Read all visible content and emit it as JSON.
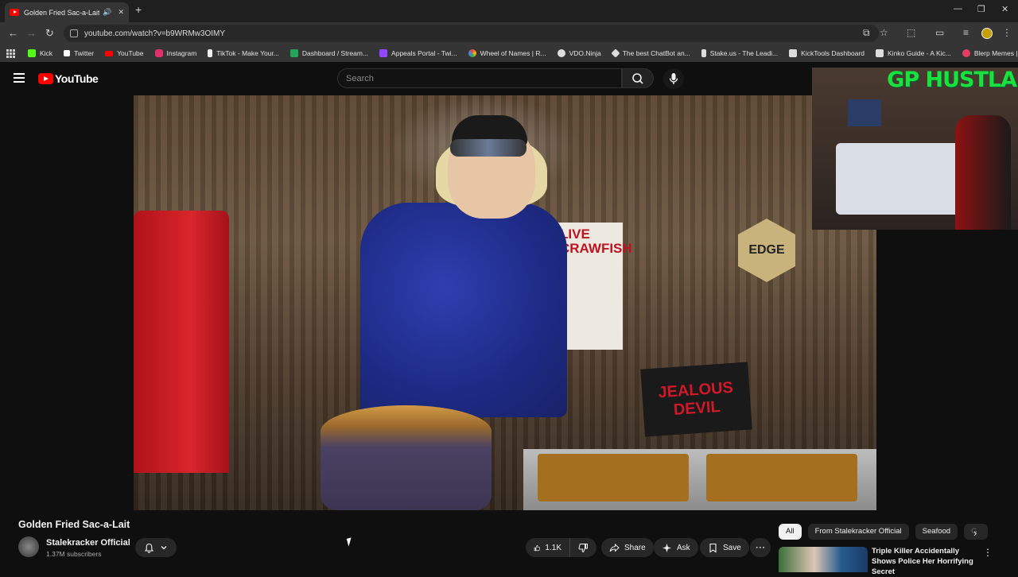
{
  "browser": {
    "tab_title": "Golden Fried Sac-a-Lait - Yo",
    "url": "youtube.com/watch?v=b9WRMw3OIMY",
    "window_controls": [
      "—",
      "❐",
      "✕"
    ]
  },
  "bookmarks": [
    {
      "label": "Kick",
      "color": "#53fc18"
    },
    {
      "label": "Twitter",
      "color": "#ffffff"
    },
    {
      "label": "YouTube",
      "color": "#ff0000"
    },
    {
      "label": "Instagram",
      "color": "#e1306c"
    },
    {
      "label": "TikTok - Make Your...",
      "color": "#ffffff"
    },
    {
      "label": "Dashboard / Stream...",
      "color": "#23a559"
    },
    {
      "label": "Appeals Portal - Twi...",
      "color": "#9146ff"
    },
    {
      "label": "Wheel of Names | R...",
      "color": "#4285f4"
    },
    {
      "label": "VDO.Ninja",
      "color": "#dddddd"
    },
    {
      "label": "The best ChatBot an...",
      "color": "#dddddd"
    },
    {
      "label": "Stake.us - The Leadi...",
      "color": "#1a2c38"
    },
    {
      "label": "KickTools Dashboard",
      "color": "#dddddd"
    },
    {
      "label": "Kinko Guide - A Kic...",
      "color": "#dddddd"
    },
    {
      "label": "Blerp Memes | Best...",
      "color": "#e63e62"
    }
  ],
  "youtube": {
    "logo_text": "YouTube",
    "search_placeholder": "Search"
  },
  "video_scene": {
    "signs": {
      "edge_text": "EDGE",
      "jealous_line1": "JEALOUS",
      "jealous_line2": "DEVIL",
      "crawfish_line1": "LIVE",
      "crawfish_line2": "CRAWFISH"
    }
  },
  "webcam": {
    "overlay_text": "GP HUSTLA"
  },
  "video_info": {
    "title": "Golden Fried Sac-a-Lait",
    "channel_name": "Stalekracker Official",
    "subscribers": "1.37M subscribers",
    "likes": "1.1K",
    "share_label": "Share",
    "ask_label": "Ask",
    "save_label": "Save"
  },
  "sidebar": {
    "chips": [
      "All",
      "From Stalekracker Official",
      "Seafood",
      "G"
    ],
    "recommendation_title": "Triple Killer Accidentally Shows Police Her Horrifying Secret"
  }
}
